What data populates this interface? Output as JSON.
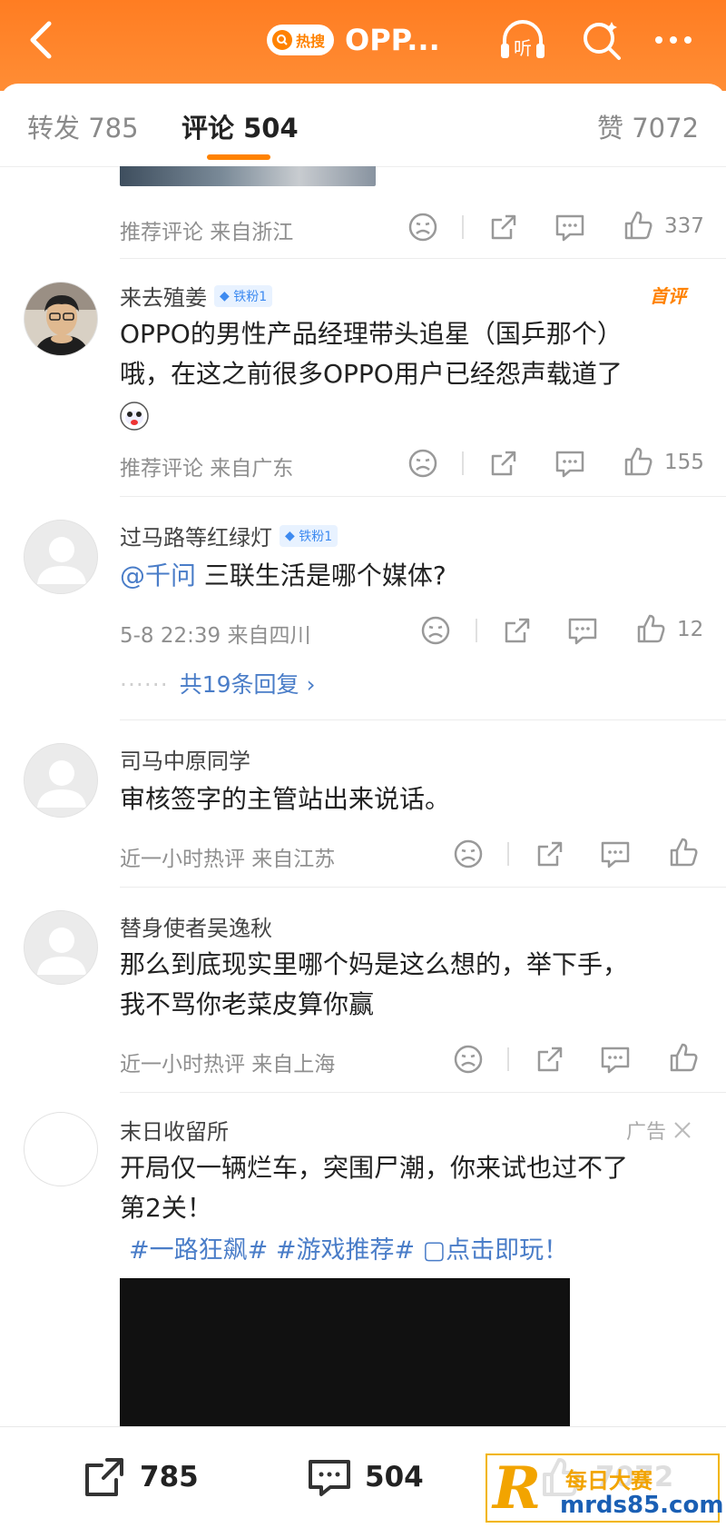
{
  "header": {
    "hot_label": "热搜",
    "title": "OPP...",
    "listen_label": "听",
    "accent_color": "#ff8200"
  },
  "tabs": {
    "repost": "转发 785",
    "comment": "评论 504",
    "like": "赞 7072"
  },
  "comments": [
    {
      "meta": "推荐评论  来自浙江",
      "like_count": "337"
    },
    {
      "username": "来去殖姜",
      "fan_badge": "铁粉1",
      "first_label": "首评",
      "text_line1": "OPPO的男性产品经理带头追星（国乒那个）",
      "text_line2": "哦，在这之前很多OPPO用户已经怨声载道了",
      "meta": "推荐评论  来自广东",
      "like_count": "155"
    },
    {
      "username": "过马路等红绿灯",
      "fan_badge": "铁粉1",
      "mention": "@千问",
      "text": " 三联生活是哪个媒体?",
      "meta": "5-8 22:39  来自四川",
      "like_count": "12",
      "replies_dots": "······",
      "replies": "共19条回复 ›"
    },
    {
      "username": "司马中原同学",
      "text": "审核签字的主管站出来说话。",
      "meta": "近一小时热评  来自江苏"
    },
    {
      "username": "替身使者吴逸秋",
      "text_line1": "那么到底现实里哪个妈是这么想的，举下手，",
      "text_line2": "我不骂你老菜皮算你赢",
      "meta": "近一小时热评  来自上海"
    },
    {
      "username": "末日收留所",
      "ad_label": "广告",
      "text_line1": "开局仅一辆烂车，突围尸潮，你来试也过不了",
      "text_line2": "第2关！",
      "tags": "#一路狂飙#  #游戏推荐#  ▢点击即玩！"
    }
  ],
  "bottom_bar": {
    "repost_count": "785",
    "comment_count": "504",
    "like_count": "7072"
  },
  "watermark": {
    "mark": "R",
    "line1": "每日大赛",
    "line2": "mrds85.com"
  }
}
